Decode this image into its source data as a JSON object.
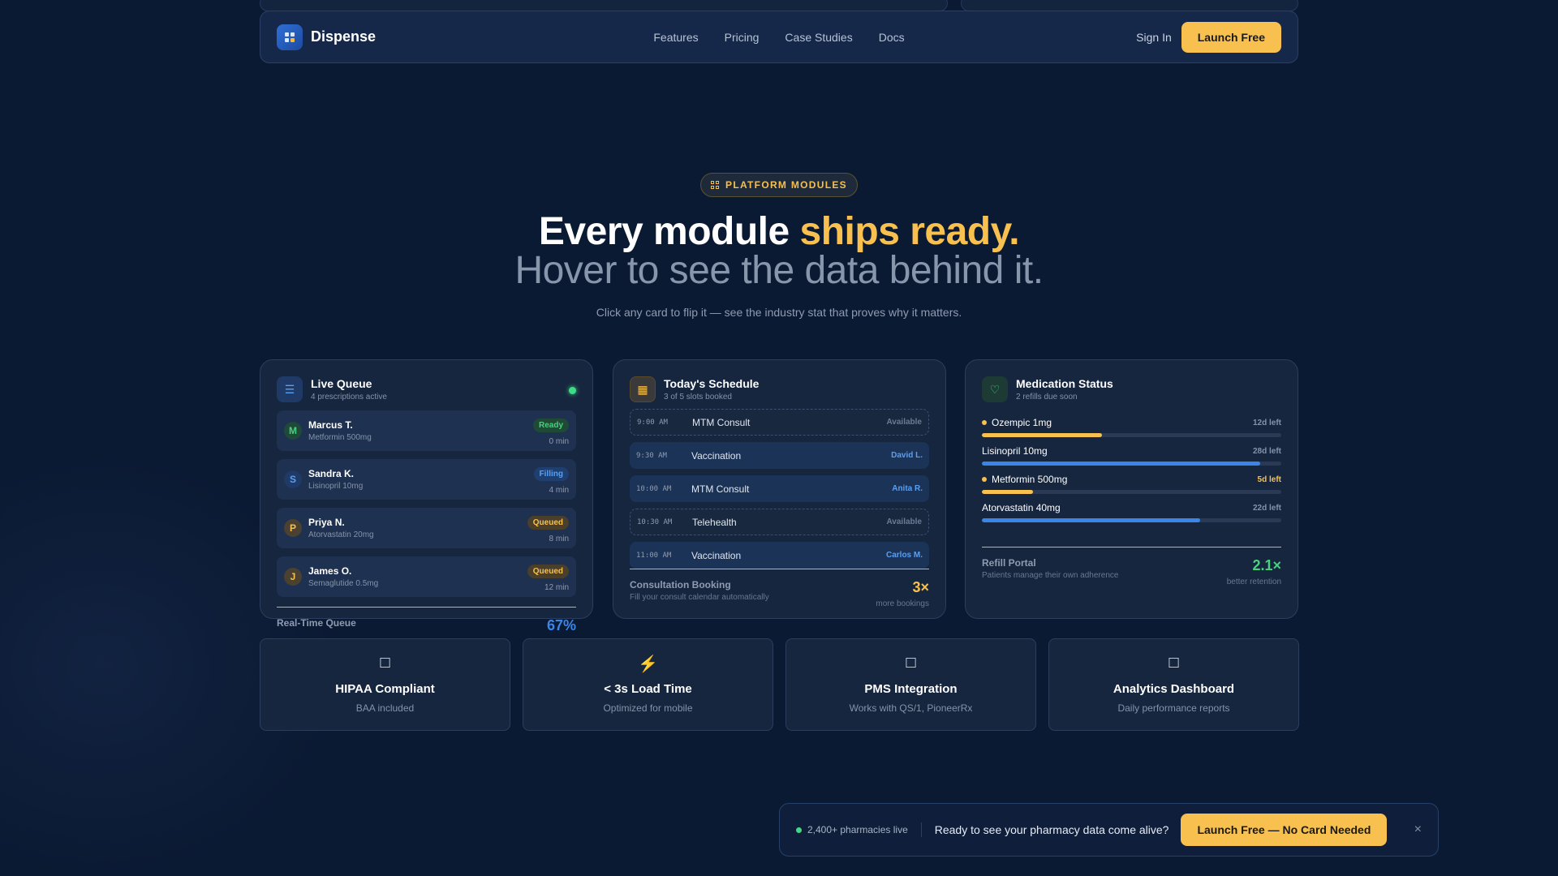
{
  "nav": {
    "brand": "Dispense",
    "links": [
      "Features",
      "Pricing",
      "Case Studies",
      "Docs"
    ],
    "signin": "Sign In",
    "cta": "Launch Free"
  },
  "hero": {
    "badge": "PLATFORM MODULES",
    "title_main": "Every module ",
    "title_accent": "ships ready.",
    "title_sub": "Hover to see the data behind it.",
    "subtitle": "Click any card to flip it — see the industry stat that proves why it matters."
  },
  "queue": {
    "title": "Live Queue",
    "subtitle": "4 prescriptions active",
    "rows": [
      {
        "initial": "M",
        "name": "Marcus T.",
        "med": "Metformin 500mg",
        "status": "Ready",
        "time": "0 min"
      },
      {
        "initial": "S",
        "name": "Sandra K.",
        "med": "Lisinopril 10mg",
        "status": "Filling",
        "time": "4 min"
      },
      {
        "initial": "P",
        "name": "Priya N.",
        "med": "Atorvastatin 20mg",
        "status": "Queued",
        "time": "8 min"
      },
      {
        "initial": "J",
        "name": "James O.",
        "med": "Semaglutide 0.5mg",
        "status": "Queued",
        "time": "12 min"
      }
    ],
    "footer_title": "Real-Time Queue",
    "footer_stat": "67%"
  },
  "schedule": {
    "title": "Today's Schedule",
    "subtitle": "3 of 5 slots booked",
    "rows": [
      {
        "time": "9:00 AM",
        "type": "MTM Consult",
        "who": "Available"
      },
      {
        "time": "9:30 AM",
        "type": "Vaccination",
        "who": "David L."
      },
      {
        "time": "10:00 AM",
        "type": "MTM Consult",
        "who": "Anita R."
      },
      {
        "time": "10:30 AM",
        "type": "Telehealth",
        "who": "Available"
      },
      {
        "time": "11:00 AM",
        "type": "Vaccination",
        "who": "Carlos M."
      }
    ],
    "footer_title": "Consultation Booking",
    "footer_desc": "Fill your consult calendar automatically",
    "footer_stat": "3×",
    "footer_stat_label": "more bookings"
  },
  "meds": {
    "title": "Medication Status",
    "subtitle": "2 refills due soon",
    "rows": [
      {
        "name": "Ozempic 1mg",
        "left": "12d left",
        "level": 0.4,
        "warn": true
      },
      {
        "name": "Lisinopril 10mg",
        "left": "28d left",
        "level": 0.93,
        "warn": false
      },
      {
        "name": "Metformin 500mg",
        "left": "5d left",
        "level": 0.17,
        "warn": true
      },
      {
        "name": "Atorvastatin 40mg",
        "left": "22d left",
        "level": 0.73,
        "warn": false
      }
    ],
    "footer_title": "Refill Portal",
    "footer_desc": "Patients manage their own adherence",
    "footer_stat": "2.1×",
    "footer_stat_label": "better retention"
  },
  "features": [
    {
      "icon": "□",
      "title": "HIPAA Compliant",
      "sub": "BAA included"
    },
    {
      "icon": "⚡",
      "title": "< 3s Load Time",
      "sub": "Optimized for mobile"
    },
    {
      "icon": "□",
      "title": "PMS Integration",
      "sub": "Works with QS/1, PioneerRx"
    },
    {
      "icon": "□",
      "title": "Analytics Dashboard",
      "sub": "Daily performance reports"
    }
  ],
  "cta_bar": {
    "live": "2,400+ pharmacies live",
    "question": "Ready to see your pharmacy data come alive?",
    "button": "Launch Free — No Card Needed",
    "close": "×"
  },
  "colors": {
    "accent": "#f7c04f",
    "blue": "#3a86e8",
    "green": "#3ddc84",
    "background": "#0b1a33"
  }
}
